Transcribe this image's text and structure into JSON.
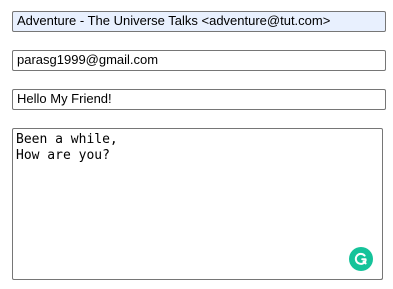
{
  "compose": {
    "from_value": "Adventure - The Universe Talks <adventure@tut.com>",
    "to_value": "parasg1999@gmail.com",
    "subject_value": "Hello My Friend!",
    "body_value": "Been a while,\nHow are you?"
  },
  "icons": {
    "grammarly": "grammarly-icon",
    "grammarly_color": "#15c39a"
  },
  "colors": {
    "autofill_background": "#e8f0fe",
    "border": "#767676"
  }
}
